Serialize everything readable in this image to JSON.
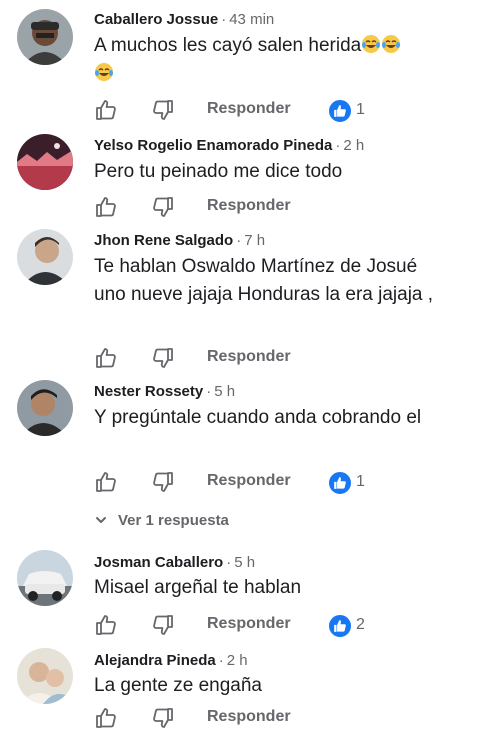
{
  "ui": {
    "reply_label": "Responder",
    "dot": "·"
  },
  "comments": [
    {
      "name": "Caballero Jossue",
      "time": "43 min",
      "text_line1": "A muchos les cayó salen herida",
      "reactions": "1",
      "emoji": "face-with-tears-of-joy"
    },
    {
      "name": "Yelso Rogelio Enamorado Pineda",
      "time": "2 h",
      "text": "Pero tu peinado me dice todo"
    },
    {
      "name": "Jhon Rene Salgado",
      "time": "7 h",
      "text": "Te hablan Oswaldo Martínez de Josué uno nueve jajaja Honduras la era jajaja ,"
    },
    {
      "name": "Nester Rossety",
      "time": "5 h",
      "text": "Y pregúntale cuando anda cobrando el",
      "reactions": "1",
      "replies_label": "Ver 1 respuesta"
    },
    {
      "name": "Josman Caballero",
      "time": "5 h",
      "text": "Misael argeñal te hablan",
      "reactions": "2"
    },
    {
      "name": "Alejandra Pineda",
      "time": "2 h",
      "text": "La gente ze engaña"
    }
  ],
  "colors": {
    "text": "#1c1e21",
    "secondary": "#65676b",
    "like_blue": "#1877f2"
  }
}
